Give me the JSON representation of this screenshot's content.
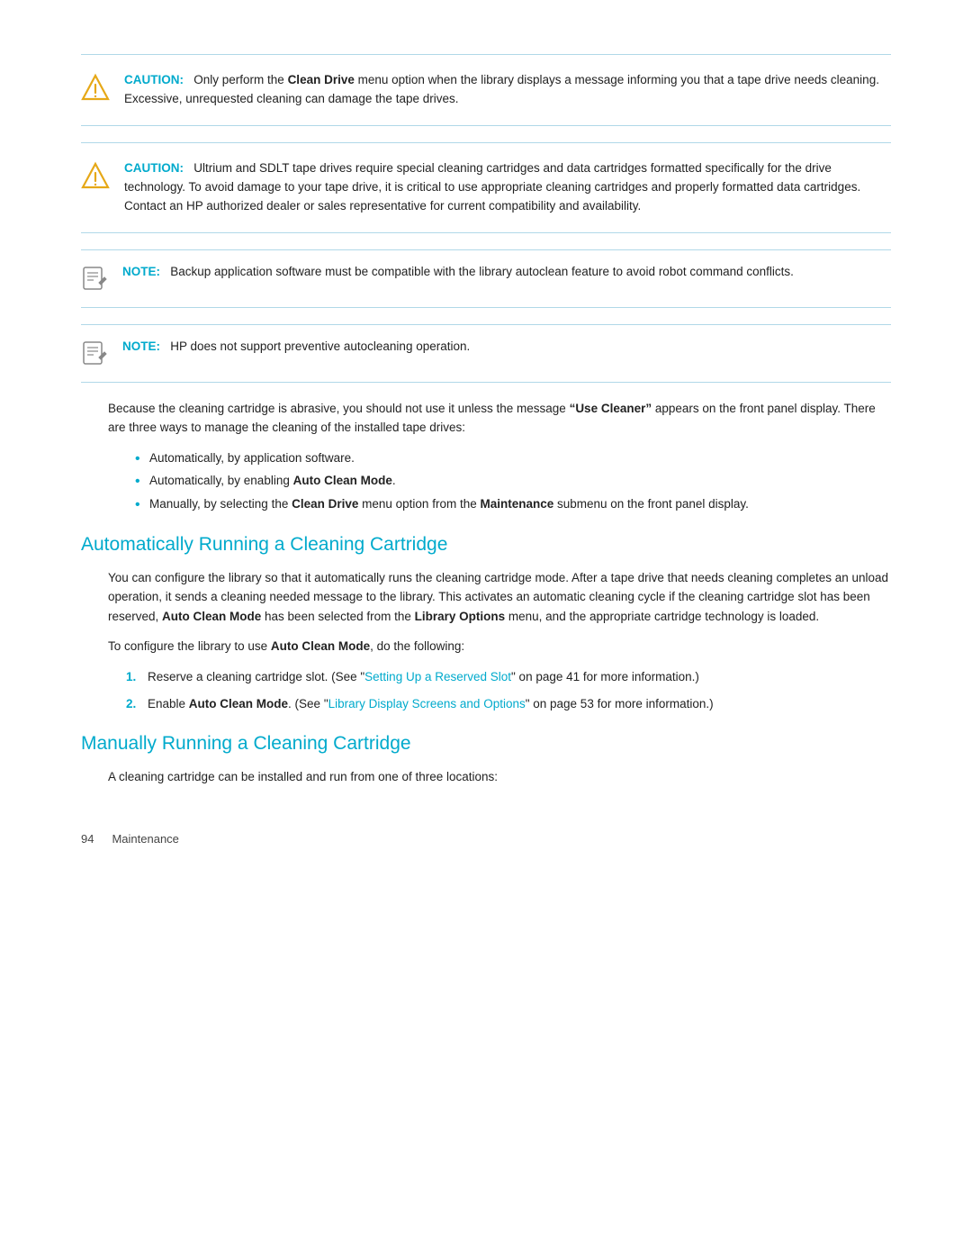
{
  "caution1": {
    "label": "CAUTION:",
    "text": "Only perform the ",
    "bold1": "Clean Drive",
    "text2": " menu option when the library displays a message informing you that a tape drive needs cleaning. Excessive, unrequested cleaning can damage the tape drives."
  },
  "caution2": {
    "label": "CAUTION:",
    "text": "Ultrium and SDLT tape drives require special cleaning cartridges and data cartridges formatted specifically for the drive technology. To avoid damage to your tape drive, it is critical to use appropriate cleaning cartridges and properly formatted data cartridges. Contact an HP authorized dealer or sales representative for current compatibility and availability."
  },
  "note1": {
    "label": "NOTE:",
    "text": "Backup application software must be compatible with the library autoclean feature to avoid robot command conflicts."
  },
  "note2": {
    "label": "NOTE:",
    "text": "HP does not support preventive autocleaning operation."
  },
  "intro_text": "Because the cleaning cartridge is abrasive, you should not use it unless the message ",
  "use_cleaner_bold": "“Use Cleaner”",
  "intro_text2": " appears on the front panel display. There are three ways to manage the cleaning of the installed tape drives:",
  "bullets": [
    "Automatically, by application software.",
    {
      "text": "Automatically, by enabling ",
      "bold": "Auto Clean Mode",
      "suffix": "."
    },
    {
      "text": "Manually, by selecting the ",
      "bold1": "Clean Drive",
      "mid": " menu option from the ",
      "bold2": "Maintenance",
      "suffix": " submenu on the front panel display."
    }
  ],
  "section1_heading": "Automatically Running a Cleaning Cartridge",
  "section1_body": "You can configure the library so that it automatically runs the cleaning cartridge mode. After a tape drive that needs cleaning completes an unload operation, it sends a cleaning needed message to the library. This activates an automatic cleaning cycle if the cleaning cartridge slot has been reserved, ",
  "section1_bold1": "Auto Clean Mode",
  "section1_mid": " has been selected from the ",
  "section1_bold2": "Library Options",
  "section1_end": " menu, and the appropriate cartridge technology is loaded.",
  "section1_configure": "To configure the library to use ",
  "section1_configure_bold": "Auto Clean Mode",
  "section1_configure_end": ", do the following:",
  "steps": [
    {
      "text": "Reserve a cleaning cartridge slot. (See “",
      "link": "Setting Up a Reserved Slot",
      "text2": "” on page 41 for more information.)"
    },
    {
      "text": "Enable ",
      "bold": "Auto Clean Mode",
      "text2": ". (See “",
      "link": "Library Display Screens and Options",
      "text3": "” on page 53 for more information.)"
    }
  ],
  "section2_heading": "Manually Running a Cleaning Cartridge",
  "section2_body": "A cleaning cartridge can be installed and run from one of three locations:",
  "footer": {
    "page_number": "94",
    "section": "Maintenance"
  }
}
